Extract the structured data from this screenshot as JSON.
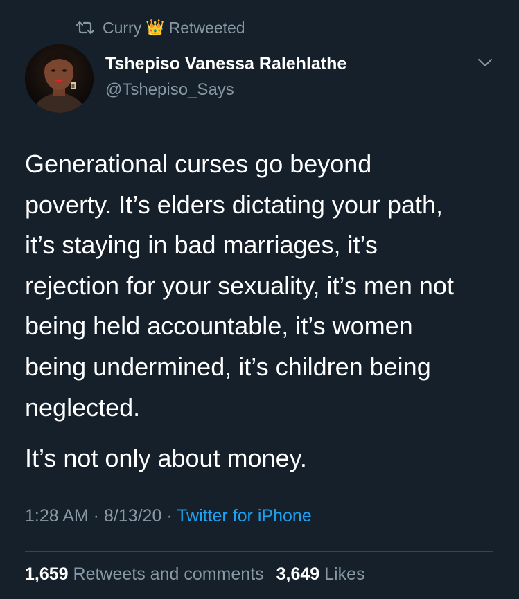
{
  "retweet_banner": {
    "user": "Curry",
    "crown_emoji": "👑",
    "action": "Retweeted",
    "icon": "retweet-icon"
  },
  "author": {
    "display_name": "Tshepiso Vanessa Ralehlathe",
    "handle": "@Tshepiso_Says",
    "avatar_icon": "profile-photo"
  },
  "tweet": {
    "lines": [
      "Generational curses go beyond",
      "poverty. It’s elders dictating your path,",
      "it’s staying in bad marriages, it’s",
      "rejection for your sexuality, it’s men not",
      "being held accountable, it’s women",
      "being undermined, it’s children being",
      "neglected."
    ],
    "second_paragraph": "It’s not only about money."
  },
  "meta": {
    "time": "1:28 AM",
    "sep1": " · ",
    "date": "8/13/20",
    "sep2": " · ",
    "source": "Twitter for iPhone"
  },
  "stats": {
    "retweets_count": "1,659",
    "retweets_label": "Retweets and comments",
    "likes_count": "3,649",
    "likes_label": "Likes"
  },
  "colors": {
    "background": "#15202b",
    "primary_text": "#ffffff",
    "secondary_text": "#8899a6",
    "link": "#1da1f2",
    "divider": "#38444d"
  }
}
